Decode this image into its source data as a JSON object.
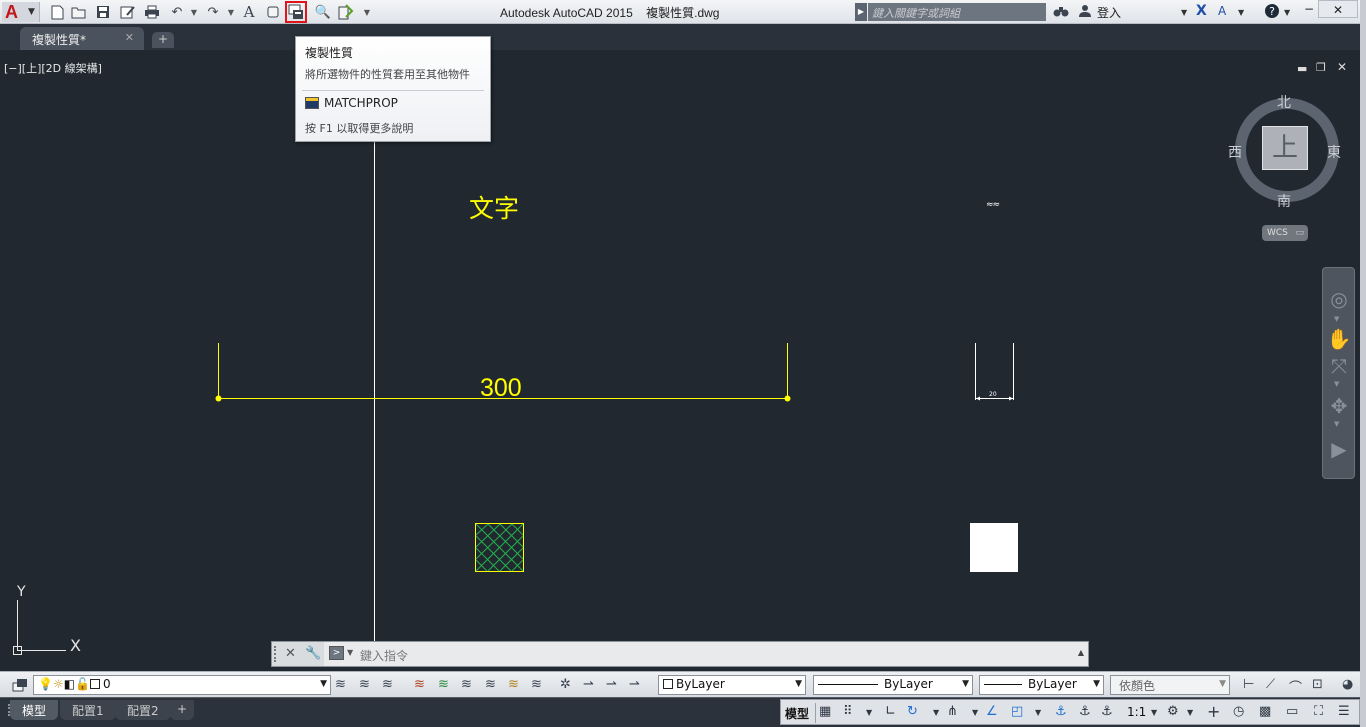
{
  "app": {
    "title": "Autodesk AutoCAD 2015",
    "file_name": "複製性質.dwg",
    "logo_letter": "A"
  },
  "search": {
    "placeholder": "鍵入關鍵字或詞組"
  },
  "user": {
    "login_label": "登入"
  },
  "tabs": {
    "file_tab": "複製性質*",
    "close_glyph": "✕",
    "new_tab_glyph": "+"
  },
  "viewport": {
    "label": "[−][上][2D 線架構]"
  },
  "tooltip": {
    "title": "複製性質",
    "description": "將所選物件的性質套用至其他物件",
    "command": "MATCHPROP",
    "help": "按 F1 以取得更多說明"
  },
  "drawing": {
    "text_object": "文字",
    "dimension_value": "300",
    "small_dimension_value": "20",
    "small_annotation": "≈≈",
    "yellow": "#ffff00",
    "green_hatch": "#22b04a",
    "crosshair": "#ffffff"
  },
  "viewcube": {
    "face": "上",
    "north": "北",
    "south": "南",
    "east": "東",
    "west": "西",
    "wcs": "WCS"
  },
  "ucs": {
    "x": "X",
    "y": "Y"
  },
  "command_line": {
    "placeholder": "鍵入指令"
  },
  "properties": {
    "layer": "0",
    "color": "ByLayer",
    "linetype": "ByLayer",
    "lineweight": "ByLayer",
    "plotstyle": "依顏色"
  },
  "layout_tabs": {
    "model": "模型",
    "layout1": "配置1",
    "layout2": "配置2",
    "add": "+"
  },
  "status": {
    "model": "模型",
    "scale": "1:1"
  }
}
